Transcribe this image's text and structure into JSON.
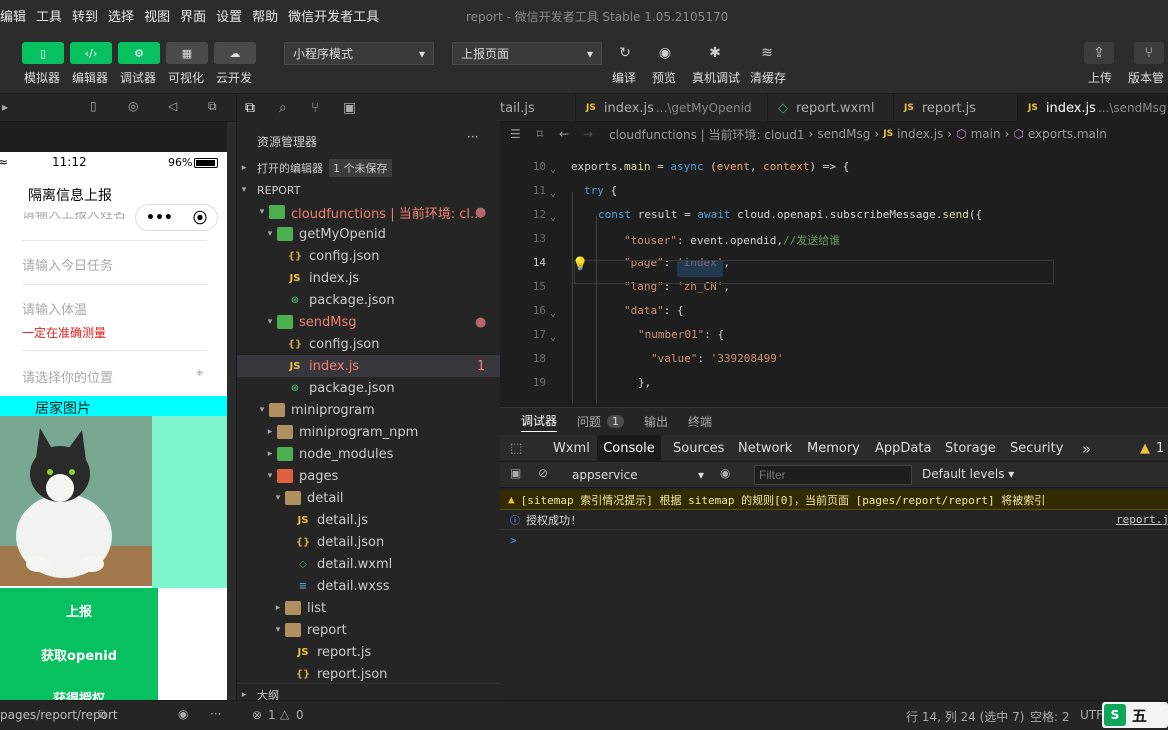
{
  "menu": [
    "编辑",
    "工具",
    "转到",
    "选择",
    "视图",
    "界面",
    "设置",
    "帮助",
    "微信开发者工具"
  ],
  "window_title": "report - 微信开发者工具 Stable 1.05.2105170",
  "toolbar": {
    "buttons": [
      "模拟器",
      "编辑器",
      "调试器",
      "可视化",
      "云开发"
    ],
    "mode_select": "小程序模式",
    "page_select": "上报页面",
    "right_actions": [
      "编译",
      "预览",
      "真机调试",
      "清缓存"
    ],
    "far_right": [
      "上传",
      "版本管"
    ]
  },
  "simulator": {
    "time": "11:12",
    "battery": "96%",
    "nav_title": "隔离信息上报",
    "capsule_dots": "•••",
    "placeholders": [
      "请输入上报人姓名",
      "请输入今日任务",
      "请输入体温",
      "请选择你的位置"
    ],
    "temp_hint": "一定在准确测量",
    "photo_label": "居家图片",
    "buttons": [
      "上报",
      "获取openid",
      "获得授权"
    ],
    "bottom_path": "pages/report/report"
  },
  "explorer": {
    "title": "资源管理器",
    "more": "···",
    "open_editors": "打开的编辑器",
    "unsaved": "1 个未保存",
    "root": "REPORT",
    "outline": "大纲",
    "items": [
      {
        "label": "cloudfunctions | 当前环境: cl...",
        "icon": "folder-cloud"
      },
      {
        "label": "getMyOpenid",
        "icon": "folder-cloud"
      },
      {
        "label": "config.json",
        "icon": "json"
      },
      {
        "label": "index.js",
        "icon": "js"
      },
      {
        "label": "package.json",
        "icon": "pkg"
      },
      {
        "label": "sendMsg",
        "icon": "folder-cloud"
      },
      {
        "label": "config.json",
        "icon": "json"
      },
      {
        "label": "index.js",
        "icon": "js",
        "badge": "1"
      },
      {
        "label": "package.json",
        "icon": "pkg"
      },
      {
        "label": "miniprogram",
        "icon": "folder"
      },
      {
        "label": "miniprogram_npm",
        "icon": "folder"
      },
      {
        "label": "node_modules",
        "icon": "folder"
      },
      {
        "label": "pages",
        "icon": "folder-red"
      },
      {
        "label": "detail",
        "icon": "folder"
      },
      {
        "label": "detail.js",
        "icon": "js"
      },
      {
        "label": "detail.json",
        "icon": "json"
      },
      {
        "label": "detail.wxml",
        "icon": "wxml"
      },
      {
        "label": "detail.wxss",
        "icon": "wxss"
      },
      {
        "label": "list",
        "icon": "folder"
      },
      {
        "label": "report",
        "icon": "folder"
      },
      {
        "label": "report.js",
        "icon": "js"
      },
      {
        "label": "report.json",
        "icon": "json"
      }
    ]
  },
  "tabs": [
    {
      "label": "tail.js",
      "sub": ""
    },
    {
      "label": "index.js",
      "sub": "...\\getMyOpenid"
    },
    {
      "label": "report.wxml",
      "sub": ""
    },
    {
      "label": "report.js",
      "sub": ""
    },
    {
      "label": "index.js",
      "sub": "...\\sendMsg"
    }
  ],
  "breadcrumb": [
    "cloudfunctions | 当前环境: cloud1",
    "sendMsg",
    "index.js",
    "main",
    "exports.main"
  ],
  "code": {
    "line_numbers": [
      "10",
      "11",
      "12",
      "13",
      "14",
      "15",
      "16",
      "17",
      "18",
      "19"
    ],
    "lines": [
      [
        [
          "exports",
          "pl"
        ],
        [
          ".",
          "pl"
        ],
        [
          "main",
          "fn"
        ],
        [
          " = ",
          "pl"
        ],
        [
          "async",
          "kw"
        ],
        [
          " (",
          "pl"
        ],
        [
          "event",
          "param"
        ],
        [
          ", ",
          "pl"
        ],
        [
          "context",
          "param"
        ],
        [
          ") => {",
          "pl"
        ]
      ],
      [
        [
          "try",
          "kw"
        ],
        [
          " {",
          "pl"
        ]
      ],
      [
        [
          "const",
          "kw"
        ],
        [
          " result = ",
          "pl"
        ],
        [
          "await",
          "kw"
        ],
        [
          " cloud.openapi.subscribeMessage.",
          "pl"
        ],
        [
          "send",
          "fn"
        ],
        [
          "({",
          "pl"
        ]
      ],
      [
        [
          "\"touser\"",
          "str"
        ],
        [
          ": event.opendid,",
          "pl"
        ],
        [
          "//发送给谁",
          "cm"
        ]
      ],
      [
        [
          "\"page\"",
          "str"
        ],
        [
          ": ",
          "pl"
        ],
        [
          "'index'",
          "str"
        ],
        [
          ",",
          "pl"
        ]
      ],
      [
        [
          "\"lang\"",
          "str"
        ],
        [
          ": ",
          "pl"
        ],
        [
          "'zh_CN'",
          "str"
        ],
        [
          ",",
          "pl"
        ]
      ],
      [
        [
          "\"data\"",
          "str"
        ],
        [
          ": {",
          "pl"
        ]
      ],
      [
        [
          "\"number01\"",
          "str"
        ],
        [
          ": {",
          "pl"
        ]
      ],
      [
        [
          "\"value\"",
          "str"
        ],
        [
          ": ",
          "pl"
        ],
        [
          "'339208499'",
          "str"
        ]
      ],
      [
        [
          "},",
          "pl"
        ]
      ]
    ]
  },
  "debugger": {
    "panel_tabs": [
      "调试器",
      "问题",
      "输出",
      "终端"
    ],
    "problem_count": "1",
    "dev_tabs": [
      "Wxml",
      "Console",
      "Sources",
      "Network",
      "Memory",
      "AppData",
      "Storage",
      "Security"
    ],
    "more": "»",
    "warn_count": "1",
    "context": "appservice",
    "filter_placeholder": "Filter",
    "levels": "Default levels",
    "messages": [
      {
        "text": "[sitemap 索引情况提示] 根据 sitemap 的规则[0]，当前页面 [pages/report/report] 将被索引",
        "type": "warn"
      },
      {
        "text": "授权成功!",
        "type": "info",
        "source": "report.js"
      }
    ],
    "prompt": ">"
  },
  "status": {
    "errors": "1",
    "warnings": "0",
    "position": "行 14, 列 24 (选中 7)",
    "spaces": "空格: 2",
    "encoding": "UTF"
  },
  "watermark": "五"
}
